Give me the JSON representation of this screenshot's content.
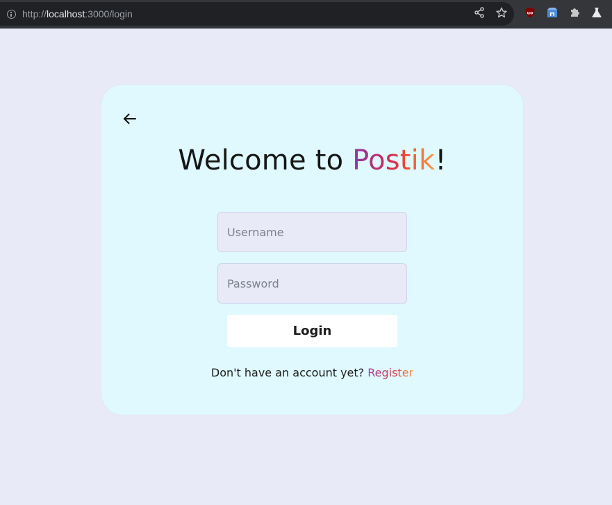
{
  "browser": {
    "url_scheme": "http://",
    "url_host": "localhost",
    "url_path": ":3000/login",
    "icons": [
      "info-icon",
      "share-icon",
      "star-icon",
      "ublock-icon",
      "extension-icon",
      "puzzle-icon",
      "lab-icon"
    ]
  },
  "page": {
    "title_prefix": "Welcome to ",
    "brand": "Postik",
    "title_suffix": "!",
    "username_placeholder": "Username",
    "password_placeholder": "Password",
    "login_label": "Login",
    "footer_text": "Don't have an account yet? ",
    "register_label": "Register"
  },
  "colors": {
    "background": "#e8eaf7",
    "card": "#dff9fe",
    "input": "#e8eaf7",
    "button": "#ffffff",
    "brand_gradient": [
      "#8b3aa8",
      "#d42a55",
      "#ee4a2f",
      "#f7a04c"
    ]
  }
}
